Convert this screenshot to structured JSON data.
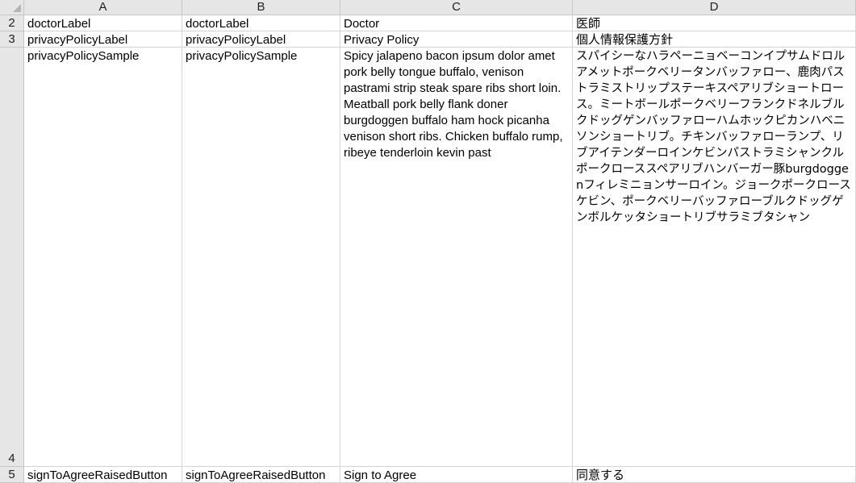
{
  "columns": [
    "A",
    "B",
    "C",
    "D"
  ],
  "rows": [
    {
      "number": "2",
      "cells": [
        "doctorLabel",
        "doctorLabel",
        "Doctor",
        "医師"
      ]
    },
    {
      "number": "3",
      "cells": [
        "privacyPolicyLabel",
        "privacyPolicyLabel",
        "Privacy Policy",
        "個人情報保護方針"
      ]
    },
    {
      "number": "4",
      "cells": [
        "privacyPolicySample",
        "privacyPolicySample",
        "Spicy jalapeno bacon ipsum dolor amet pork belly tongue buffalo, venison pastrami strip steak spare ribs short loin. Meatball pork belly flank doner burgdoggen buffalo ham hock picanha venison short ribs. Chicken buffalo rump, ribeye tenderloin kevin past",
        "スパイシーなハラペーニョベーコンイプサムドロルアメットポークベリータンバッファロー、鹿肉パストラミストリップステーキスペアリブショートロース。ミートボールポークベリーフランクドネルブルクドッグゲンバッファローハムホックピカンハベニソンショートリブ。チキンバッファローランプ、リブアイテンダーロインケビンパストラミシャンクルポークローススペアリブハンバーガー豚burgdoggenフィレミニョンサーロイン。ジョークポークロースケビン、ポークベリーバッファローブルクドッグゲンボルケッタショートリブサラミブタシャン"
      ]
    },
    {
      "number": "5",
      "cells": [
        "signToAgreeRaisedButton",
        "signToAgreeRaisedButton",
        "Sign to Agree",
        "同意する"
      ]
    }
  ]
}
